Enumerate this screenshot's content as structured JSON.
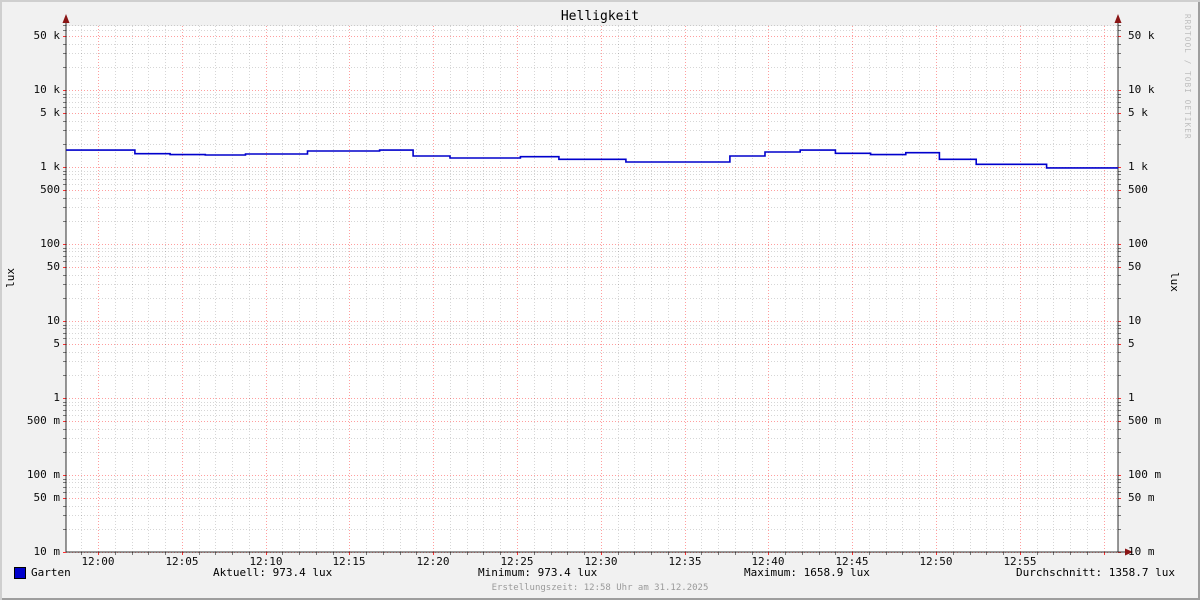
{
  "title": "Helligkeit",
  "watermark": "RRDTOOL / TOBI OETIKER",
  "axis": {
    "left_label": "lux",
    "right_label": "lux"
  },
  "legend": {
    "series": {
      "label": "Garten",
      "color": "#0000cc"
    },
    "aktuell": "Aktuell: 973.4 lux",
    "minimum": "Minimum: 973.4 lux",
    "maximum": "Maximum: 1658.9 lux",
    "durchschnitt": "Durchschnitt: 1358.7 lux"
  },
  "footer": "Erstellungszeit: 12:58 Uhr am 31.12.2025",
  "colors": {
    "background": "#f1f1f1",
    "canvas": "#ffffff",
    "line": "#0000cc",
    "major_grid": "#ff0000",
    "minor_grid": "#000000",
    "axis": "#1a1a1a",
    "arrow": "#8a1515"
  },
  "chart_data": {
    "type": "line",
    "step": true,
    "title": "Helligkeit",
    "ylabel": "lux",
    "y_scale": "log",
    "ylim": [
      0.01,
      50000
    ],
    "x_window_minutes": {
      "start": -1.9,
      "end": 60.9,
      "reference": "12:00"
    },
    "grid": {
      "style": "dotted",
      "major": "red",
      "minor": "gray",
      "legend_position": "bottom"
    },
    "x_ticks": [
      {
        "min": 0,
        "label": "12:00"
      },
      {
        "min": 5,
        "label": "12:05"
      },
      {
        "min": 10,
        "label": "12:10"
      },
      {
        "min": 15,
        "label": "12:15"
      },
      {
        "min": 20,
        "label": "12:20"
      },
      {
        "min": 25,
        "label": "12:25"
      },
      {
        "min": 30,
        "label": "12:30"
      },
      {
        "min": 35,
        "label": "12:35"
      },
      {
        "min": 40,
        "label": "12:40"
      },
      {
        "min": 45,
        "label": "12:45"
      },
      {
        "min": 50,
        "label": "12:50"
      },
      {
        "min": 55,
        "label": "12:55"
      }
    ],
    "y_ticks": [
      {
        "value": 50000,
        "label": "50 k"
      },
      {
        "value": 10000,
        "label": "10 k"
      },
      {
        "value": 5000,
        "label": "5 k"
      },
      {
        "value": 1000,
        "label": "1 k"
      },
      {
        "value": 500,
        "label": "500"
      },
      {
        "value": 100,
        "label": "100"
      },
      {
        "value": 50,
        "label": "50"
      },
      {
        "value": 10,
        "label": "10"
      },
      {
        "value": 5,
        "label": "5"
      },
      {
        "value": 1,
        "label": "1"
      },
      {
        "value": 0.5,
        "label": "500 m"
      },
      {
        "value": 0.1,
        "label": "100 m"
      },
      {
        "value": 0.05,
        "label": "50 m"
      },
      {
        "value": 0.01,
        "label": "10 m"
      }
    ],
    "series": [
      {
        "name": "Garten",
        "color": "#0000cc",
        "points_min_lux": [
          [
            -1.9,
            1659
          ],
          [
            2.2,
            1490
          ],
          [
            4.3,
            1447
          ],
          [
            6.4,
            1432
          ],
          [
            8.8,
            1475
          ],
          [
            12.5,
            1613
          ],
          [
            16.8,
            1659
          ],
          [
            18.8,
            1390
          ],
          [
            21.0,
            1309
          ],
          [
            25.2,
            1360
          ],
          [
            27.5,
            1258
          ],
          [
            31.5,
            1161
          ],
          [
            37.7,
            1390
          ],
          [
            39.8,
            1566
          ],
          [
            41.9,
            1659
          ],
          [
            44.0,
            1505
          ],
          [
            46.1,
            1447
          ],
          [
            48.2,
            1535
          ],
          [
            50.2,
            1258
          ],
          [
            52.4,
            1084
          ],
          [
            56.6,
            973.4
          ]
        ]
      }
    ],
    "stats": {
      "aktuell_lux": 973.4,
      "minimum_lux": 973.4,
      "maximum_lux": 1658.9,
      "durchschnitt_lux": 1358.7
    }
  }
}
